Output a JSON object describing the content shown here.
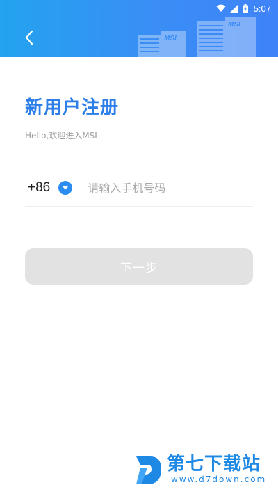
{
  "status_bar": {
    "time": "5:07",
    "icons": [
      "wifi-icon",
      "signal-icon",
      "battery-icon"
    ]
  },
  "header": {
    "back_icon": "chevron-left-icon",
    "decoration_text": "MSI"
  },
  "page": {
    "title": "新用户注册",
    "subtitle": "Hello,欢迎进入MSI"
  },
  "phone": {
    "country_code": "+86",
    "dropdown_icon": "chevron-down-icon",
    "placeholder": "请输入手机号码",
    "value": ""
  },
  "actions": {
    "next_label": "下一步"
  },
  "watermark": {
    "title": "第七下载站",
    "url": "www.d7down.com"
  },
  "colors": {
    "accent": "#2c7ee8",
    "header_start": "#23a3f0",
    "header_end": "#3f83f8",
    "button_disabled": "#e2e2e2",
    "dropdown": "#2d8cf0"
  }
}
